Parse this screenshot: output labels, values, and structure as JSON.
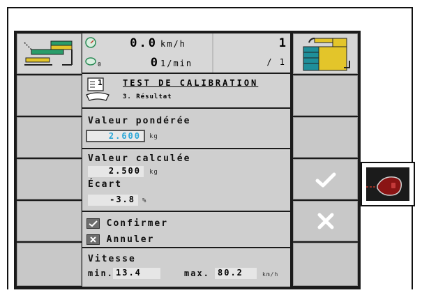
{
  "header": {
    "speed_value": "0.0",
    "speed_unit": "km/h",
    "rpm_value": "0",
    "rpm_unit": "1/min",
    "rpm_icon_sub": "0",
    "page_number": "1",
    "page_total": "/ 1"
  },
  "dialog": {
    "icon_number": "1",
    "title": "TEST DE CALIBRATION",
    "step": "3. Résultat",
    "weighted": {
      "label": "Valeur pondérée",
      "value": "2.600",
      "unit": "kg"
    },
    "calculated": {
      "label": "Valeur calculée",
      "value": "2.500",
      "unit": "kg"
    },
    "deviation": {
      "label": "Écart",
      "value": "-3.8",
      "unit": "%"
    },
    "confirm_label": "Confirmer",
    "cancel_label": "Annuler",
    "speed": {
      "label": "Vitesse",
      "min_label": "min.",
      "min_value": "13.4",
      "max_label": "max.",
      "max_value": "80.2",
      "unit": "km/h"
    }
  },
  "colors": {
    "accent": "#2aa7d8",
    "confirm": "#ffffff",
    "terminal_bg": "#1b1b1b",
    "panel": "#d2d2d2"
  },
  "icons": {
    "left_top": "implement-layout-icon",
    "right_top": "implement-swap-icon",
    "speed": "speedometer-icon",
    "rpm": "pto-icon",
    "dialog": "calibration-scale-icon",
    "confirm": "checkmark-icon",
    "cancel": "close-icon",
    "external": "hand-controller-icon"
  }
}
